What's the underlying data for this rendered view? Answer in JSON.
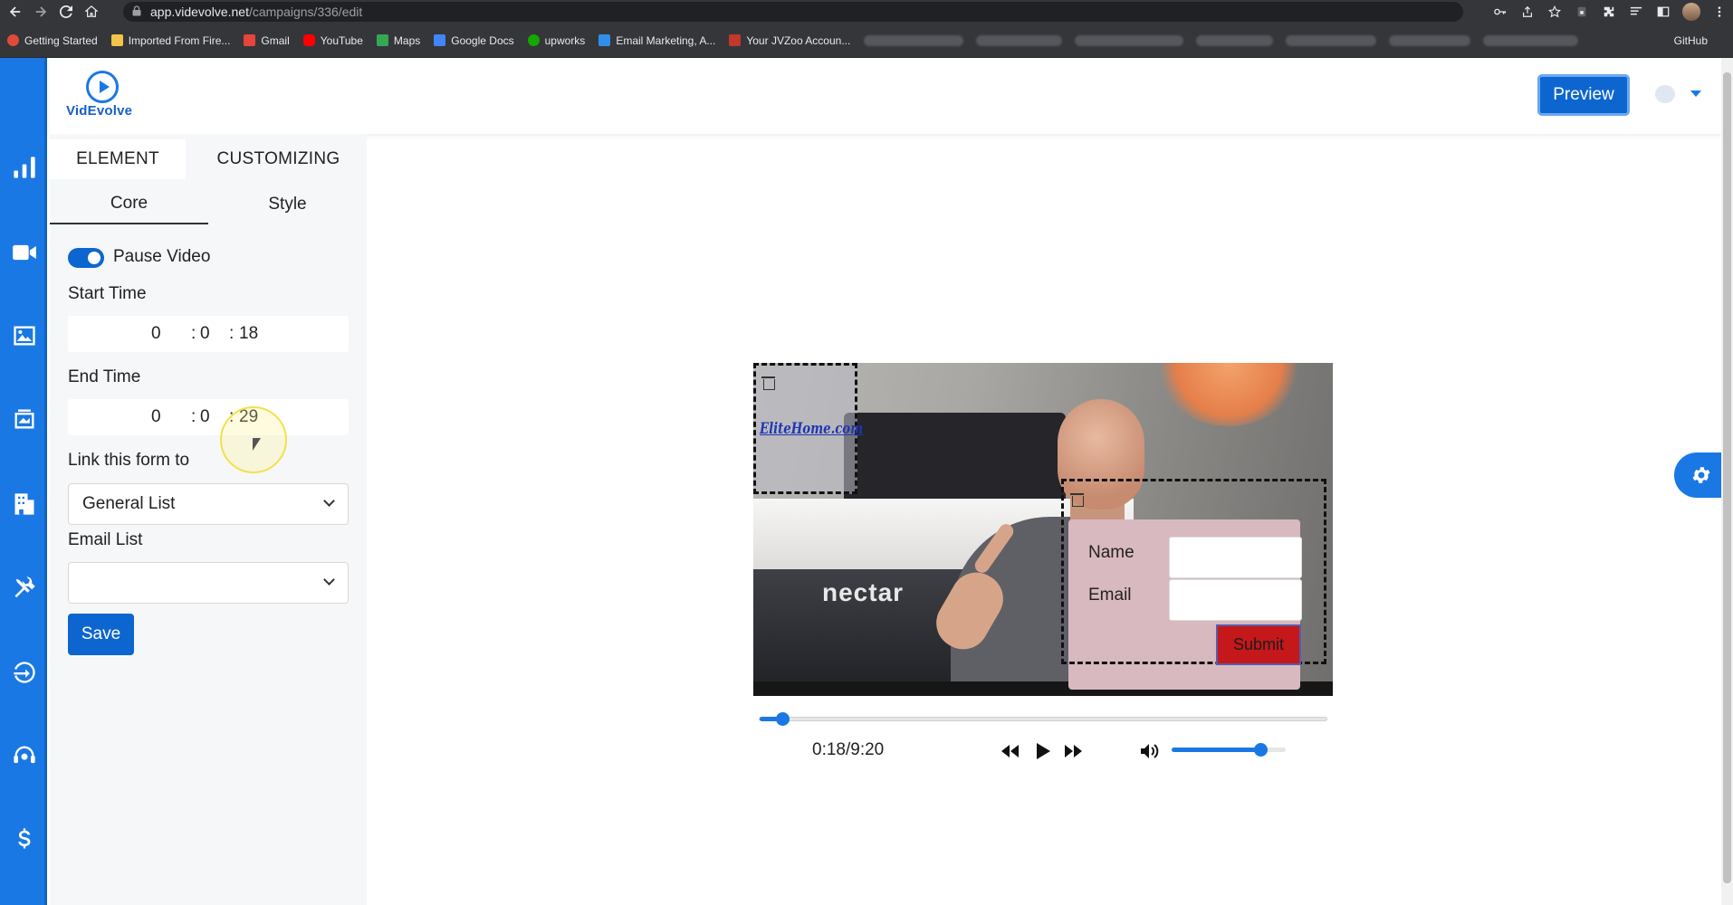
{
  "browser": {
    "url_host": "app.videvolve.net",
    "url_path": "/campaigns/336/edit",
    "bookmarks": [
      {
        "label": "Getting Started",
        "color": "#e04a3a"
      },
      {
        "label": "Imported From Fire...",
        "color": "#f3c449"
      },
      {
        "label": "Gmail",
        "color": "#e5453c"
      },
      {
        "label": "YouTube",
        "color": "#ff0000"
      },
      {
        "label": "Maps",
        "color": "#35a853"
      },
      {
        "label": "Google Docs",
        "color": "#4285f4"
      },
      {
        "label": "upworks",
        "color": "#14a800"
      },
      {
        "label": "Email Marketing, A...",
        "color": "#2f8fe8"
      },
      {
        "label": "Your JVZoo Accoun...",
        "color": "#c0392b"
      }
    ],
    "github_label": "GitHub"
  },
  "rail": {
    "icons": [
      "stats-icon",
      "video-icon",
      "image-icon",
      "template-icon",
      "building-icon",
      "tools-icon",
      "logout-icon",
      "support-icon",
      "dollar-icon"
    ],
    "color": "#1a78e4"
  },
  "header": {
    "logo_text": "VidEvolve",
    "preview_label": "Preview"
  },
  "panel": {
    "tabs": [
      "ELEMENT",
      "CUSTOMIZING"
    ],
    "active_tab": "ELEMENT",
    "subtabs": [
      "Core",
      "Style"
    ],
    "active_subtab": "Core",
    "pause_video_label": "Pause Video",
    "pause_video_on": true,
    "start_time_label": "Start Time",
    "start_time": {
      "h": "0",
      "m": "0",
      "s": "18"
    },
    "end_time_label": "End Time",
    "end_time": {
      "h": "0",
      "m": "0",
      "s": "29"
    },
    "time_sep": ":",
    "link_label": "Link this form to",
    "link_value": "General List",
    "email_list_label": "Email List",
    "email_list_value": "",
    "save_label": "Save"
  },
  "video": {
    "overlay_logo_text": "EliteHome.com",
    "mattress_brand": "nectar",
    "form": {
      "name_label": "Name",
      "email_label": "Email",
      "submit_label": "Submit"
    },
    "current_time": "0:18",
    "duration": "9:20",
    "time_display": "0:18/9:20",
    "progress_fraction": 0.032,
    "volume_fraction": 0.78
  },
  "colors": {
    "accent": "#1a78e4",
    "button": "#0d66d0",
    "submit": "#c4181a"
  }
}
